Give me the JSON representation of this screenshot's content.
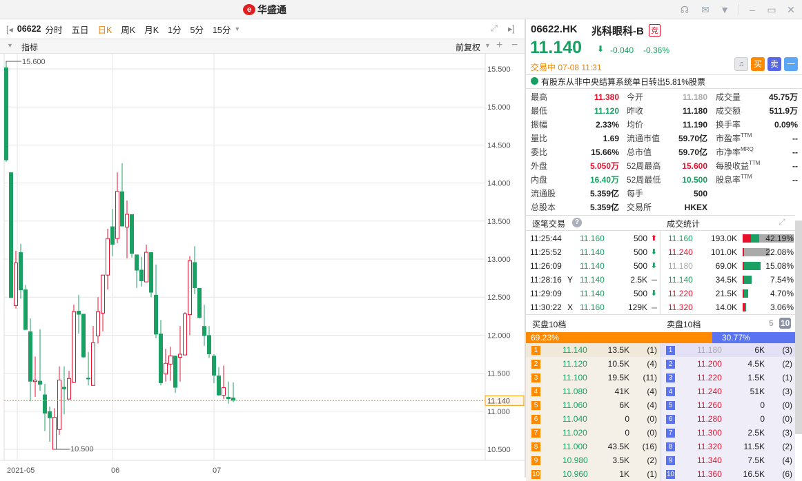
{
  "app": {
    "brand": "华盛通",
    "brand_mark": "e"
  },
  "window_icons": [
    "headset-icon",
    "mail-icon",
    "shirt-icon",
    "minimize-icon",
    "maximize-icon",
    "close-icon"
  ],
  "toolbar": {
    "code": "06622",
    "tabs": [
      {
        "label": "分时",
        "active": false
      },
      {
        "label": "五日",
        "active": false
      },
      {
        "label": "日K",
        "active": true
      },
      {
        "label": "周K",
        "active": false
      },
      {
        "label": "月K",
        "active": false
      },
      {
        "label": "1分",
        "active": false
      },
      {
        "label": "5分",
        "active": false
      },
      {
        "label": "15分",
        "active": false
      }
    ]
  },
  "indicator_row": {
    "label": "指标",
    "adjust": "前复权"
  },
  "colors": {
    "up": "#e8112d",
    "down": "#1aa062",
    "accent": "#f08200",
    "sell_blue": "#5a73f0"
  },
  "chart_data": {
    "type": "candlestick",
    "ylim": [
      10.4,
      15.75
    ],
    "yticks": [
      "15.500",
      "15.000",
      "14.500",
      "14.000",
      "13.500",
      "13.000",
      "12.500",
      "12.000",
      "11.500",
      "11.000",
      "10.500"
    ],
    "ytick_values": [
      15.5,
      15.0,
      14.5,
      14.0,
      13.5,
      13.0,
      12.5,
      12.0,
      11.5,
      11.0,
      10.5
    ],
    "xticks": [
      {
        "label": "2021-05",
        "index": 2
      },
      {
        "label": "06",
        "index": 22
      },
      {
        "label": "07",
        "index": 43
      }
    ],
    "last_price": "11.140",
    "last_value": 11.14,
    "max_label": "15.600",
    "max_index": 0,
    "max_value": 15.6,
    "min_label": "10.500",
    "min_index": 10,
    "min_value": 10.5,
    "candles": [
      [
        15.52,
        15.6,
        14.28,
        14.3
      ],
      [
        14.14,
        14.14,
        12.49,
        12.49
      ],
      [
        12.39,
        13.11,
        12.35,
        12.95
      ],
      [
        13.09,
        13.2,
        12.48,
        12.59
      ],
      [
        12.6,
        12.66,
        12.07,
        12.07
      ],
      [
        12.05,
        12.22,
        11.13,
        11.39
      ],
      [
        11.39,
        11.72,
        11.19,
        11.41
      ],
      [
        11.4,
        12.08,
        11.27,
        11.35
      ],
      [
        11.22,
        11.36,
        10.74,
        10.97
      ],
      [
        11.0,
        11.06,
        10.6,
        10.91
      ],
      [
        10.5,
        11.04,
        10.5,
        10.92
      ],
      [
        10.76,
        11.59,
        10.69,
        11.41
      ],
      [
        11.32,
        11.59,
        10.96,
        11.29
      ],
      [
        11.16,
        11.53,
        11.16,
        11.43
      ],
      [
        11.38,
        12.4,
        11.37,
        12.31
      ],
      [
        12.32,
        12.53,
        12.02,
        12.27
      ],
      [
        12.28,
        12.28,
        11.7,
        11.71
      ],
      [
        11.44,
        11.78,
        11.34,
        11.42
      ],
      [
        11.34,
        12.12,
        11.34,
        11.9
      ],
      [
        11.99,
        12.5,
        11.89,
        12.31
      ],
      [
        12.29,
        12.79,
        12.05,
        12.79
      ],
      [
        12.79,
        13.4,
        12.6,
        13.27
      ],
      [
        13.43,
        13.66,
        13.04,
        13.19
      ],
      [
        13.27,
        14.14,
        13.21,
        13.89
      ],
      [
        13.89,
        14.26,
        13.43,
        13.43
      ],
      [
        13.42,
        13.77,
        13.01,
        13.59
      ],
      [
        13.59,
        13.59,
        13.02,
        13.07
      ],
      [
        13.06,
        13.06,
        12.62,
        12.85
      ],
      [
        12.86,
        13.03,
        12.64,
        12.71
      ],
      [
        12.7,
        13.19,
        12.7,
        13.09
      ],
      [
        13.09,
        13.09,
        12.5,
        12.56
      ],
      [
        12.53,
        12.93,
        11.96,
        12.01
      ],
      [
        12.02,
        12.2,
        11.34,
        11.37
      ],
      [
        11.49,
        11.82,
        11.39,
        11.63
      ],
      [
        11.62,
        11.85,
        11.4,
        11.73
      ],
      [
        11.73,
        11.73,
        11.24,
        11.31
      ],
      [
        11.71,
        12.12,
        11.39,
        11.75
      ],
      [
        11.74,
        12.3,
        11.74,
        12.28
      ],
      [
        12.27,
        13.04,
        12.0,
        12.98
      ],
      [
        12.96,
        13.17,
        12.54,
        12.62
      ],
      [
        12.62,
        12.62,
        12.22,
        12.23
      ],
      [
        12.12,
        12.4,
        11.86,
        11.99
      ],
      [
        12.0,
        12.12,
        11.7,
        11.75
      ],
      [
        11.73,
        11.75,
        11.37,
        11.47
      ],
      [
        11.47,
        11.58,
        11.2,
        11.21
      ],
      [
        11.21,
        11.6,
        11.16,
        11.31
      ],
      [
        11.19,
        11.39,
        11.1,
        11.16
      ],
      [
        11.18,
        11.38,
        11.12,
        11.14
      ]
    ]
  },
  "quote": {
    "symbol": "06622.HK",
    "name": "兆科眼科-B",
    "tag": "竞",
    "price": "11.140",
    "change": "-0.040",
    "change_pct": "-0.36%",
    "status": "交易中 07-08 11:31",
    "buy": "买",
    "sell": "卖",
    "collapse": "一",
    "notice": "有股东从非中央结算系统单日转出5.81%股票"
  },
  "stats": [
    [
      {
        "l": "最高",
        "v": "11.380",
        "c": "red"
      },
      {
        "l": "今开",
        "v": "11.180",
        "c": "gray"
      },
      {
        "l": "成交量",
        "v": "45.75万",
        "c": ""
      }
    ],
    [
      {
        "l": "最低",
        "v": "11.120",
        "c": "green"
      },
      {
        "l": "昨收",
        "v": "11.180",
        "c": ""
      },
      {
        "l": "成交额",
        "v": "511.9万",
        "c": ""
      }
    ],
    [
      {
        "l": "振幅",
        "v": "2.33%",
        "c": ""
      },
      {
        "l": "均价",
        "v": "11.190",
        "c": ""
      },
      {
        "l": "换手率",
        "v": "0.09%",
        "c": ""
      }
    ],
    [
      {
        "l": "量比",
        "v": "1.69",
        "c": ""
      },
      {
        "l": "流通市值",
        "v": "59.70亿",
        "c": ""
      },
      {
        "l": "市盈率",
        "s": "TTM",
        "v": "--",
        "c": ""
      }
    ],
    [
      {
        "l": "委比",
        "v": "15.66%",
        "c": ""
      },
      {
        "l": "总市值",
        "v": "59.70亿",
        "c": ""
      },
      {
        "l": "市净率",
        "s": "MRQ",
        "v": "--",
        "c": ""
      }
    ],
    [
      {
        "l": "外盘",
        "v": "5.050万",
        "c": "red"
      },
      {
        "l": "52周最高",
        "v": "15.600",
        "c": "red"
      },
      {
        "l": "每股收益",
        "s": "TTM",
        "v": "--",
        "c": ""
      }
    ],
    [
      {
        "l": "内盘",
        "v": "16.40万",
        "c": "green"
      },
      {
        "l": "52周最低",
        "v": "10.500",
        "c": "green"
      },
      {
        "l": "股息率",
        "s": "TTM",
        "v": "--",
        "c": ""
      }
    ],
    [
      {
        "l": "流通股",
        "v": "5.359亿",
        "c": ""
      },
      {
        "l": "每手",
        "v": "500",
        "c": ""
      }
    ],
    [
      {
        "l": "总股本",
        "v": "5.359亿",
        "c": ""
      },
      {
        "l": "交易所",
        "v": "HKEX",
        "c": ""
      }
    ]
  ],
  "trades": {
    "title": "逐笔交易",
    "help": "?",
    "rows": [
      {
        "time": "11:25:44",
        "flag": "",
        "price": "11.160",
        "vol": "500",
        "dir": "up"
      },
      {
        "time": "11:25:52",
        "flag": "",
        "price": "11.140",
        "vol": "500",
        "dir": "down"
      },
      {
        "time": "11:26:09",
        "flag": "",
        "price": "11.140",
        "vol": "500",
        "dir": "down"
      },
      {
        "time": "11:28:16",
        "flag": "Y",
        "price": "11.140",
        "vol": "2.5K",
        "dir": "flat"
      },
      {
        "time": "11:29:09",
        "flag": "",
        "price": "11.140",
        "vol": "500",
        "dir": "down"
      },
      {
        "time": "11:30:22",
        "flag": "X",
        "price": "11.160",
        "vol": "129K",
        "dir": "flat"
      }
    ]
  },
  "volume_stats": {
    "title": "成交统计",
    "rows": [
      {
        "price": "11.160",
        "c": "green",
        "vol": "193.0K",
        "pct": "42.19%",
        "share": 42.19,
        "mix": [
          0.16,
          0.16,
          0.68
        ]
      },
      {
        "price": "11.240",
        "c": "red",
        "vol": "101.0K",
        "pct": "22.08%",
        "share": 22.08,
        "mix": [
          0.03,
          0,
          0.97
        ]
      },
      {
        "price": "11.180",
        "c": "gray",
        "vol": "69.0K",
        "pct": "15.08%",
        "share": 15.08,
        "mix": [
          0.02,
          0.98,
          0
        ]
      },
      {
        "price": "11.140",
        "c": "green",
        "vol": "34.5K",
        "pct": "7.54%",
        "share": 7.54,
        "mix": [
          0.05,
          0.95,
          0
        ]
      },
      {
        "price": "11.220",
        "c": "red",
        "vol": "21.5K",
        "pct": "4.70%",
        "share": 4.7,
        "mix": [
          0.1,
          0.9,
          0
        ]
      },
      {
        "price": "11.320",
        "c": "red",
        "vol": "14.0K",
        "pct": "3.06%",
        "share": 3.06,
        "mix": [
          0.85,
          0.15,
          0
        ]
      }
    ]
  },
  "book": {
    "bid_title": "买盘10档",
    "ask_title": "卖盘10档",
    "depth5": "5",
    "depth10": "10",
    "bid_ratio": "69.23%",
    "bid_share": 69.23,
    "ask_ratio": "30.77%",
    "bids": [
      [
        "1",
        "11.140",
        "13.5K",
        "(1)"
      ],
      [
        "2",
        "11.120",
        "10.5K",
        "(4)"
      ],
      [
        "3",
        "11.100",
        "19.5K",
        "(11)"
      ],
      [
        "4",
        "11.080",
        "41K",
        "(4)"
      ],
      [
        "5",
        "11.060",
        "6K",
        "(4)"
      ],
      [
        "6",
        "11.040",
        "0",
        "(0)"
      ],
      [
        "7",
        "11.020",
        "0",
        "(0)"
      ],
      [
        "8",
        "11.000",
        "43.5K",
        "(16)"
      ],
      [
        "9",
        "10.980",
        "3.5K",
        "(2)"
      ],
      [
        "10",
        "10.960",
        "1K",
        "(1)"
      ]
    ],
    "asks": [
      [
        "1",
        "11.180",
        "6K",
        "(3)"
      ],
      [
        "2",
        "11.200",
        "4.5K",
        "(2)"
      ],
      [
        "3",
        "11.220",
        "1.5K",
        "(1)"
      ],
      [
        "4",
        "11.240",
        "51K",
        "(3)"
      ],
      [
        "5",
        "11.260",
        "0",
        "(0)"
      ],
      [
        "6",
        "11.280",
        "0",
        "(0)"
      ],
      [
        "7",
        "11.300",
        "2.5K",
        "(3)"
      ],
      [
        "8",
        "11.320",
        "11.5K",
        "(2)"
      ],
      [
        "9",
        "11.340",
        "7.5K",
        "(4)"
      ],
      [
        "10",
        "11.360",
        "16.5K",
        "(6)"
      ]
    ]
  }
}
